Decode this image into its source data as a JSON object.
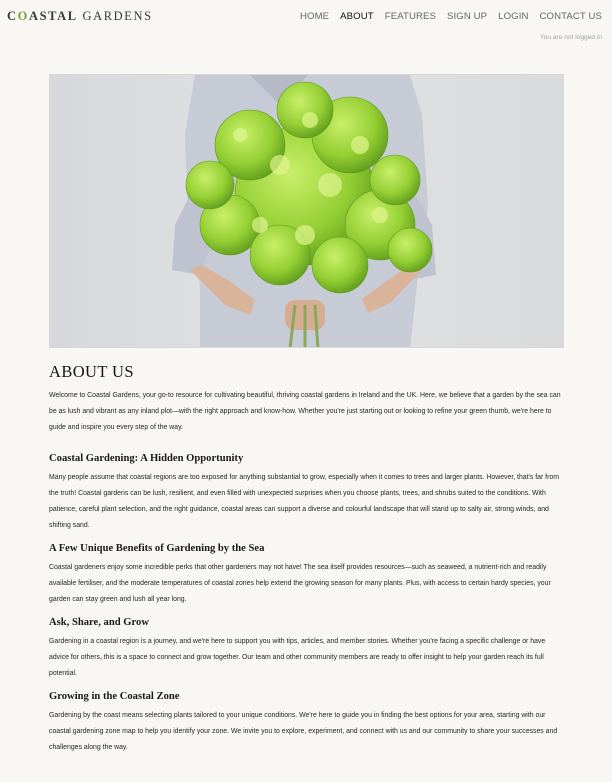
{
  "brand": {
    "logo_first": "COASTAL",
    "logo_second": "GARDENS",
    "accent_color": "#7aa33a"
  },
  "nav": {
    "items": [
      {
        "label": "HOME",
        "active": false
      },
      {
        "label": "ABOUT",
        "active": true
      },
      {
        "label": "FEATURES",
        "active": false
      },
      {
        "label": "SIGN UP",
        "active": false
      },
      {
        "label": "LOGIN",
        "active": false
      },
      {
        "label": "CONTACT US",
        "active": false
      }
    ],
    "login_status": "You are not logged in"
  },
  "hero": {
    "subject": "person-holding-green-bouquet"
  },
  "main": {
    "title": "ABOUT US",
    "intro": "Welcome to Coastal Gardens, your go-to resource for cultivating beautiful, thriving coastal gardens in Ireland and the UK. Here, we believe that a garden by the sea can be as lush and vibrant as any inland plot—with the right approach and know-how. Whether you're just starting out or looking to refine your green thumb, we're here to guide and inspire you every step of the way.",
    "sections": [
      {
        "heading": "Coastal Gardening: A Hidden Opportunity",
        "body": "Many people assume that coastal regions are too exposed for anything substantial to grow, especially when it comes to trees and larger plants. However, that's far from the truth! Coastal gardens can be lush, resilient, and even filled with unexpected surprises when you choose plants, trees, and shrubs suited to the conditions. With patience, careful plant selection, and the right guidance, coastal areas can support a diverse and colourful landscape that will stand up to salty air, strong winds, and shifting sand."
      },
      {
        "heading": "A Few Unique Benefits of Gardening by the Sea",
        "body": "Coastal gardeners enjoy some incredible perks that other gardeners may not have! The sea itself provides resources—such as seaweed, a nutrient-rich and readily available fertiliser, and the moderate temperatures of coastal zones help extend the growing season for many plants. Plus, with access to certain hardy species, your garden can stay green and lush all year long."
      },
      {
        "heading": "Ask, Share, and Grow",
        "body": "Gardening in a coastal region is a journey, and we're here to support you with tips, articles, and member stories. Whether you're facing a specific challenge or have advice for others, this is a space to connect and grow together. Our team and other community members are ready to offer insight to help your garden reach its full potential."
      },
      {
        "heading": "Growing in the Coastal Zone",
        "body": "Gardening by the coast means selecting plants tailored to your unique conditions. We're here to guide you in finding the best options for your area, starting with our coastal gardening zone map to help you identify your zone. We invite you to explore, experiment, and connect with us and our community to share your successes and challenges along the way."
      }
    ]
  }
}
